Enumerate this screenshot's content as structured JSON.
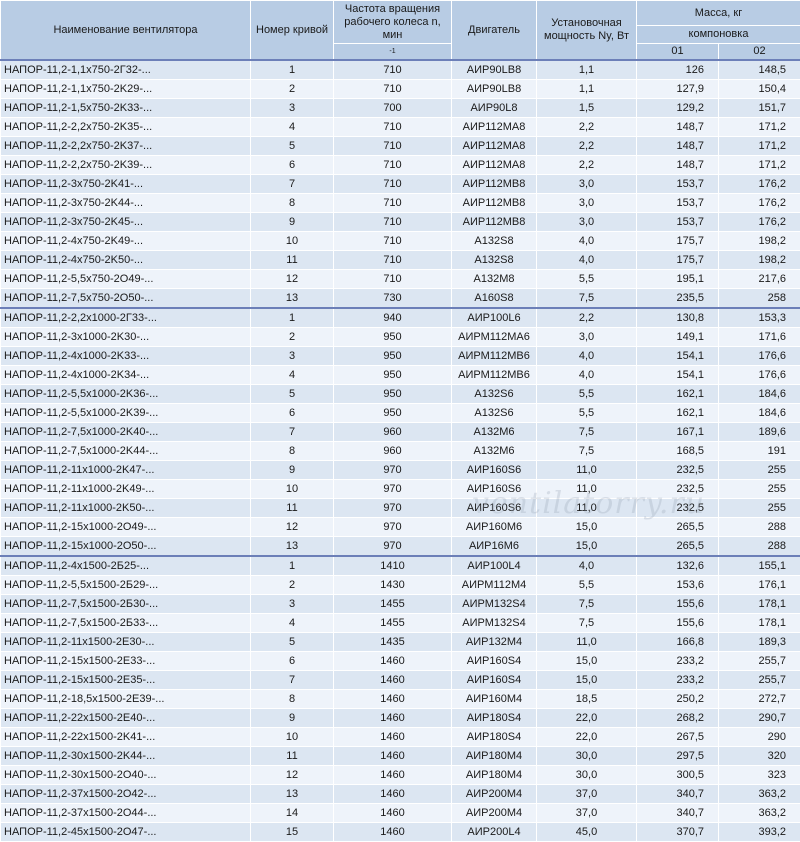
{
  "headers": {
    "name": "Наименование вентилятора",
    "curve": "Номер кривой",
    "rpm_line1": "Частота вращения",
    "rpm_line2": "рабочего колеса n, мин",
    "rpm_sup": "-1",
    "motor": "Двигатель",
    "power_line1": "Установочная",
    "power_line2": "мощность Ny, Вт",
    "mass": "Масса, кг",
    "layout": "компоновка",
    "layout_01": "01",
    "layout_02": "02"
  },
  "groups": [
    {
      "rows": [
        [
          "НАПОР-11,2-1,1x750-2Г32-...",
          "1",
          "710",
          "АИР90LB8",
          "1,1",
          "126",
          "148,5"
        ],
        [
          "НАПОР-11,2-1,1x750-2K29-...",
          "2",
          "710",
          "АИР90LB8",
          "1,1",
          "127,9",
          "150,4"
        ],
        [
          "НАПОР-11,2-1,5x750-2K33-...",
          "3",
          "700",
          "АИР90L8",
          "1,5",
          "129,2",
          "151,7"
        ],
        [
          "НАПОР-11,2-2,2x750-2K35-...",
          "4",
          "710",
          "АИР112МА8",
          "2,2",
          "148,7",
          "171,2"
        ],
        [
          "НАПОР-11,2-2,2x750-2K37-...",
          "5",
          "710",
          "АИР112МА8",
          "2,2",
          "148,7",
          "171,2"
        ],
        [
          "НАПОР-11,2-2,2x750-2K39-...",
          "6",
          "710",
          "АИР112МА8",
          "2,2",
          "148,7",
          "171,2"
        ],
        [
          "НАПОР-11,2-3x750-2K41-...",
          "7",
          "710",
          "АИР112МВ8",
          "3,0",
          "153,7",
          "176,2"
        ],
        [
          "НАПОР-11,2-3x750-2K44-...",
          "8",
          "710",
          "АИР112МВ8",
          "3,0",
          "153,7",
          "176,2"
        ],
        [
          "НАПОР-11,2-3x750-2K45-...",
          "9",
          "710",
          "АИР112МВ8",
          "3,0",
          "153,7",
          "176,2"
        ],
        [
          "НАПОР-11,2-4x750-2K49-...",
          "10",
          "710",
          "А132S8",
          "4,0",
          "175,7",
          "198,2"
        ],
        [
          "НАПОР-11,2-4x750-2K50-...",
          "11",
          "710",
          "А132S8",
          "4,0",
          "175,7",
          "198,2"
        ],
        [
          "НАПОР-11,2-5,5x750-2O49-...",
          "12",
          "710",
          "А132М8",
          "5,5",
          "195,1",
          "217,6"
        ],
        [
          "НАПОР-11,2-7,5x750-2O50-...",
          "13",
          "730",
          "А160S8",
          "7,5",
          "235,5",
          "258"
        ]
      ]
    },
    {
      "rows": [
        [
          "НАПОР-11,2-2,2x1000-2Г33-...",
          "1",
          "940",
          "АИР100L6",
          "2,2",
          "130,8",
          "153,3"
        ],
        [
          "НАПОР-11,2-3x1000-2K30-...",
          "2",
          "950",
          "АИРМ112МА6",
          "3,0",
          "149,1",
          "171,6"
        ],
        [
          "НАПОР-11,2-4x1000-2K33-...",
          "3",
          "950",
          "АИРМ112МВ6",
          "4,0",
          "154,1",
          "176,6"
        ],
        [
          "НАПОР-11,2-4x1000-2K34-...",
          "4",
          "950",
          "АИРМ112МВ6",
          "4,0",
          "154,1",
          "176,6"
        ],
        [
          "НАПОР-11,2-5,5x1000-2K36-...",
          "5",
          "950",
          "А132S6",
          "5,5",
          "162,1",
          "184,6"
        ],
        [
          "НАПОР-11,2-5,5x1000-2K39-...",
          "6",
          "950",
          "А132S6",
          "5,5",
          "162,1",
          "184,6"
        ],
        [
          "НАПОР-11,2-7,5x1000-2K40-...",
          "7",
          "960",
          "А132М6",
          "7,5",
          "167,1",
          "189,6"
        ],
        [
          "НАПОР-11,2-7,5x1000-2K44-...",
          "8",
          "960",
          "А132М6",
          "7,5",
          "168,5",
          "191"
        ],
        [
          "НАПОР-11,2-11x1000-2K47-...",
          "9",
          "970",
          "АИР160S6",
          "11,0",
          "232,5",
          "255"
        ],
        [
          "НАПОР-11,2-11x1000-2K49-...",
          "10",
          "970",
          "АИР160S6",
          "11,0",
          "232,5",
          "255"
        ],
        [
          "НАПОР-11,2-11x1000-2K50-...",
          "11",
          "970",
          "АИР160S6",
          "11,0",
          "232,5",
          "255"
        ],
        [
          "НАПОР-11,2-15x1000-2O49-...",
          "12",
          "970",
          "АИР160М6",
          "15,0",
          "265,5",
          "288"
        ],
        [
          "НАПОР-11,2-15x1000-2O50-...",
          "13",
          "970",
          "АИР16М6",
          "15,0",
          "265,5",
          "288"
        ]
      ]
    },
    {
      "rows": [
        [
          "НАПОР-11,2-4x1500-2Б25-...",
          "1",
          "1410",
          "АИР100L4",
          "4,0",
          "132,6",
          "155,1"
        ],
        [
          "НАПОР-11,2-5,5x1500-2Б29-...",
          "2",
          "1430",
          "АИРМ112М4",
          "5,5",
          "153,6",
          "176,1"
        ],
        [
          "НАПОР-11,2-7,5x1500-2Б30-...",
          "3",
          "1455",
          "АИРМ132S4",
          "7,5",
          "155,6",
          "178,1"
        ],
        [
          "НАПОР-11,2-7,5x1500-2Б33-...",
          "4",
          "1455",
          "АИРМ132S4",
          "7,5",
          "155,6",
          "178,1"
        ],
        [
          "НАПОР-11,2-11x1500-2E30-...",
          "5",
          "1435",
          "АИР132М4",
          "11,0",
          "166,8",
          "189,3"
        ],
        [
          "НАПОР-11,2-15x1500-2E33-...",
          "6",
          "1460",
          "АИР160S4",
          "15,0",
          "233,2",
          "255,7"
        ],
        [
          "НАПОР-11,2-15x1500-2E35-...",
          "7",
          "1460",
          "АИР160S4",
          "15,0",
          "233,2",
          "255,7"
        ],
        [
          "НАПОР-11,2-18,5x1500-2E39-...",
          "8",
          "1460",
          "АИР160М4",
          "18,5",
          "250,2",
          "272,7"
        ],
        [
          "НАПОР-11,2-22x1500-2E40-...",
          "9",
          "1460",
          "АИР180S4",
          "22,0",
          "268,2",
          "290,7"
        ],
        [
          "НАПОР-11,2-22x1500-2K41-...",
          "10",
          "1460",
          "АИР180S4",
          "22,0",
          "267,5",
          "290"
        ],
        [
          "НАПОР-11,2-30x1500-2K44-...",
          "11",
          "1460",
          "АИР180М4",
          "30,0",
          "297,5",
          "320"
        ],
        [
          "НАПОР-11,2-30x1500-2O40-...",
          "12",
          "1460",
          "АИР180М4",
          "30,0",
          "300,5",
          "323"
        ],
        [
          "НАПОР-11,2-37x1500-2O42-...",
          "13",
          "1460",
          "АИР200М4",
          "37,0",
          "340,7",
          "363,2"
        ],
        [
          "НАПОР-11,2-37x1500-2O44-...",
          "14",
          "1460",
          "АИР200М4",
          "37,0",
          "340,7",
          "363,2"
        ],
        [
          "НАПОР-11,2-45x1500-2O47-...",
          "15",
          "1460",
          "АИР200L4",
          "45,0",
          "370,7",
          "393,2"
        ]
      ]
    }
  ],
  "watermark": "ventilatorry.ru"
}
